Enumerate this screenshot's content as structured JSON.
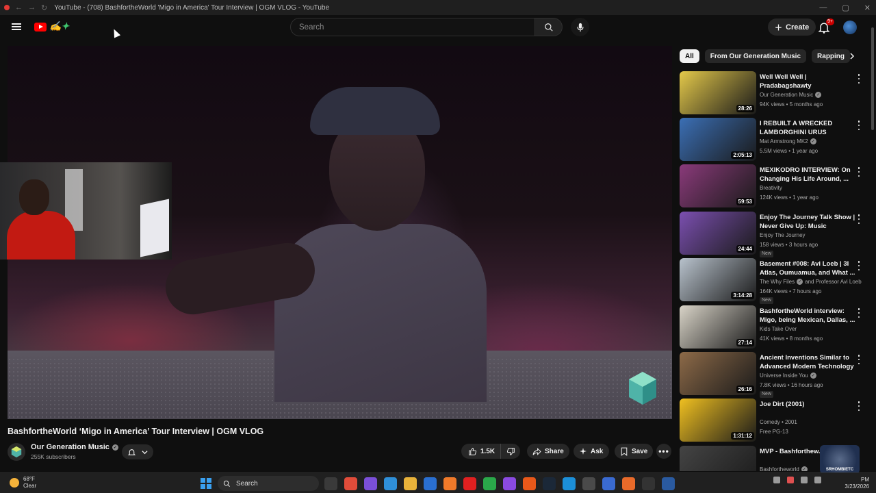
{
  "browser": {
    "window_title": "YouTube - (708) BashfortheWorld 'Migo in America' Tour Interview | OGM VLOG - YouTube"
  },
  "header": {
    "search_placeholder": "Search",
    "create_label": "Create",
    "notifications_badge": "9+"
  },
  "player": {
    "title": "BashfortheWorld ‘Migo in America’ Tour Interview | OGM VLOG"
  },
  "channel": {
    "name": "Our Generation Music",
    "subscribers": "255K subscribers"
  },
  "actions": {
    "likes": "1.5K",
    "share_label": "Share",
    "ask_label": "Ask",
    "save_label": "Save"
  },
  "chips": [
    "All",
    "From Our Generation Music",
    "Rapping"
  ],
  "recommendations": [
    {
      "title": "Well Well Well | Pradabagshawty",
      "channel": "Our Generation Music",
      "verified": true,
      "meta": "94K views • 5 months ago",
      "duration": "28:26",
      "badge": "",
      "thumb": "#e4c94a"
    },
    {
      "title": "I REBUILT A WRECKED LAMBORGHINI URUS",
      "channel": "Mat Armstrong MK2",
      "verified": true,
      "meta": "5.5M views • 1 year ago",
      "duration": "2:05:13",
      "badge": "",
      "thumb": "#3b6fb5"
    },
    {
      "title": "MEXIKODRO INTERVIEW: On Changing His Life Around, ...",
      "channel": "Breativity",
      "verified": false,
      "meta": "124K views • 1 year ago",
      "duration": "59:53",
      "badge": "",
      "thumb": "#8a3a7a"
    },
    {
      "title": "Enjoy The Journey Talk Show | Never Give Up: Music Journey,...",
      "channel": "Enjoy The Journey",
      "verified": false,
      "meta": "158 views • 3 hours ago",
      "duration": "24:44",
      "badge": "New",
      "thumb": "#7b4fb0"
    },
    {
      "title": "Basement #008: Avi Loeb | 3I Atlas, Oumuamua, and What ...",
      "channel": "The Why Files",
      "verified": true,
      "channel_extra": "and Professor Avi Loeb",
      "meta": "164K views • 7 hours ago",
      "duration": "3:14:28",
      "badge": "New",
      "thumb": "#b8c2cc"
    },
    {
      "title": "BashfortheWorld interview: Migo, being Mexican, Dallas, ...",
      "channel": "Kids Take Over",
      "verified": false,
      "meta": "41K views • 8 months ago",
      "duration": "27:14",
      "badge": "",
      "thumb": "#d9d4c8"
    },
    {
      "title": "Ancient Inventions Similar to Advanced Modern Technology",
      "channel": "Universe Inside You",
      "verified": true,
      "meta": "7.8K views • 16 hours ago",
      "duration": "26:16",
      "badge": "New",
      "thumb": "#8d6a48"
    },
    {
      "title": "Joe Dirt (2001)",
      "channel": "Comedy • 2001",
      "verified": false,
      "meta": "Free  PG-13",
      "duration": "1:31:12",
      "badge": "",
      "thumb": "#f0c020"
    },
    {
      "title": "MVP - Bashforthew...",
      "channel": "Bashfortheworld",
      "verified": true,
      "meta": "",
      "duration": "",
      "badge": "",
      "thumb": "#444444"
    }
  ],
  "streamer_overlay": "SRHOMBIETC",
  "taskbar": {
    "weather_temp": "68°F",
    "weather_desc": "Clear",
    "search_label": "Search",
    "time": "PM",
    "date": "3/23/2026"
  }
}
